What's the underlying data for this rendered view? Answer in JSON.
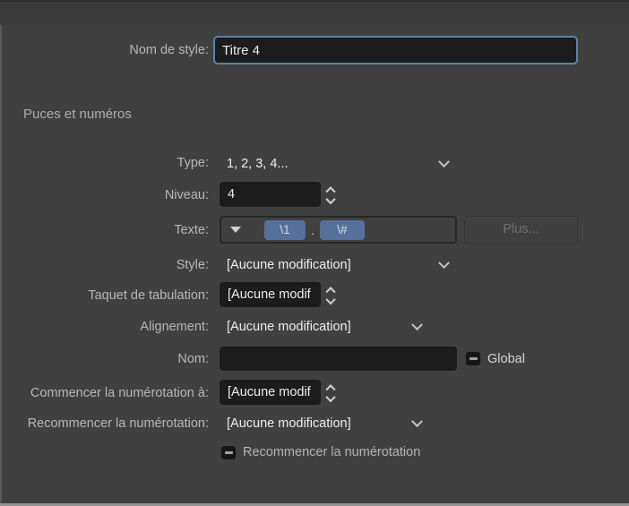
{
  "panel": {
    "bg_color": "#404040",
    "accent_focus_color": "#5d82ab",
    "token_color": "#55719b"
  },
  "name_row": {
    "label": "Nom de style:",
    "value": "Titre 4"
  },
  "section_heading": "Puces et numéros",
  "rows": {
    "type": {
      "label": "Type:",
      "value": "1, 2, 3, 4..."
    },
    "niveau": {
      "label": "Niveau:",
      "value": "4"
    },
    "texte": {
      "label": "Texte:",
      "tokens": [
        "\\1",
        "\\#"
      ],
      "separator": ".",
      "plus_button_label": "Plus..."
    },
    "style": {
      "label": "Style:",
      "value": "[Aucune modification]"
    },
    "taquet": {
      "label": "Taquet de tabulation:",
      "value": "[Aucune modif"
    },
    "alignement": {
      "label": "Alignement:",
      "value": "[Aucune modification]"
    },
    "nom": {
      "label": "Nom:",
      "value": "",
      "checkbox_label": "Global",
      "checkbox_state": "indeterminate"
    },
    "commencer": {
      "label": "Commencer la numérotation à:",
      "value": "[Aucune modif"
    },
    "recommencer": {
      "label": "Recommencer la numérotation:",
      "value": "[Aucune modification]"
    },
    "recommencer_check": {
      "label": "Recommencer la numérotation",
      "checkbox_state": "indeterminate"
    }
  }
}
